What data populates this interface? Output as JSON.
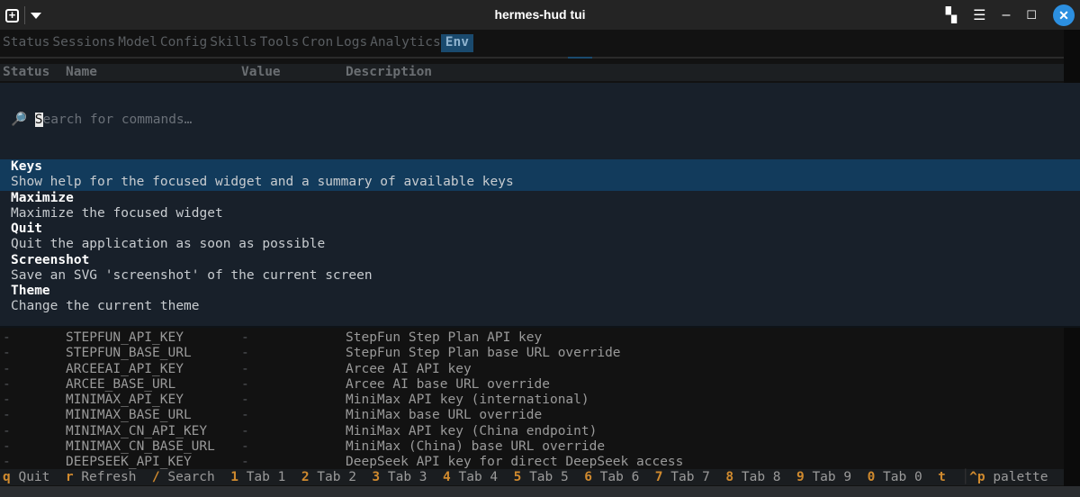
{
  "window": {
    "title": "hermes-hud tui"
  },
  "tabs": [
    "Status",
    "Sessions",
    "Model",
    "Config",
    "Skills",
    "Tools",
    "Cron",
    "Logs",
    "Analytics",
    "Env"
  ],
  "active_tab": "Env",
  "table": {
    "headers": [
      "Status",
      "Name",
      "Value",
      "Description"
    ],
    "rows": [
      [
        "-",
        "STEPFUN_API_KEY",
        "-",
        "StepFun Step Plan API key"
      ],
      [
        "-",
        "STEPFUN_BASE_URL",
        "-",
        "StepFun Step Plan base URL override"
      ],
      [
        "-",
        "ARCEEAI_API_KEY",
        "-",
        "Arcee AI API key"
      ],
      [
        "-",
        "ARCEE_BASE_URL",
        "-",
        "Arcee AI base URL override"
      ],
      [
        "-",
        "MINIMAX_API_KEY",
        "-",
        "MiniMax API key (international)"
      ],
      [
        "-",
        "MINIMAX_BASE_URL",
        "-",
        "MiniMax base URL override"
      ],
      [
        "-",
        "MINIMAX_CN_API_KEY",
        "-",
        "MiniMax API key (China endpoint)"
      ],
      [
        "-",
        "MINIMAX_CN_BASE_URL",
        "-",
        "MiniMax (China) base URL override"
      ],
      [
        "-",
        "DEEPSEEK_API_KEY",
        "-",
        "DeepSeek API key for direct DeepSeek access"
      ]
    ]
  },
  "palette": {
    "placeholder_first": "S",
    "placeholder_rest": "earch for commands…",
    "commands": [
      {
        "name": "Keys",
        "desc": "Show help for the focused widget and a summary of available keys"
      },
      {
        "name": "Maximize",
        "desc": "Maximize the focused widget"
      },
      {
        "name": "Quit",
        "desc": "Quit the application as soon as possible"
      },
      {
        "name": "Screenshot",
        "desc": "Save an SVG 'screenshot' of the current screen"
      },
      {
        "name": "Theme",
        "desc": "Change the current theme"
      }
    ]
  },
  "footer": [
    {
      "key": "q",
      "label": "Quit"
    },
    {
      "key": "r",
      "label": "Refresh"
    },
    {
      "key": "/",
      "label": "Search"
    },
    {
      "key": "1",
      "label": "Tab 1"
    },
    {
      "key": "2",
      "label": "Tab 2"
    },
    {
      "key": "3",
      "label": "Tab 3"
    },
    {
      "key": "4",
      "label": "Tab 4"
    },
    {
      "key": "5",
      "label": "Tab 5"
    },
    {
      "key": "6",
      "label": "Tab 6"
    },
    {
      "key": "7",
      "label": "Tab 7"
    },
    {
      "key": "8",
      "label": "Tab 8"
    },
    {
      "key": "9",
      "label": "Tab 9"
    },
    {
      "key": "0",
      "label": "Tab 0"
    },
    {
      "key": "t",
      "label": ""
    }
  ],
  "palette_key": {
    "key": "^p",
    "label": "palette"
  }
}
